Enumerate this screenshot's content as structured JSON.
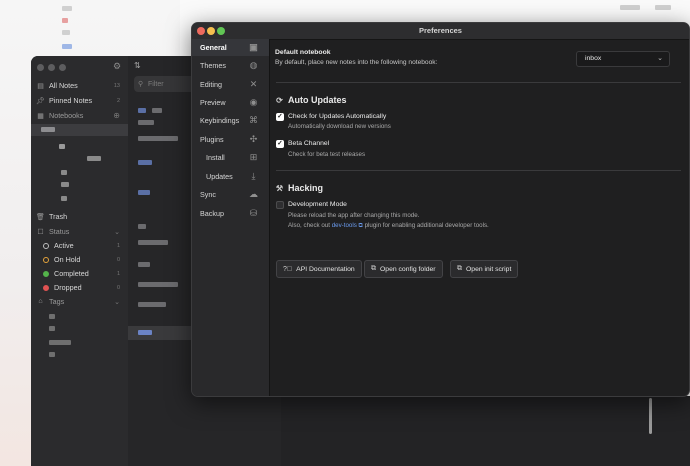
{
  "sidebar": {
    "all_notes": "All Notes",
    "all_notes_count": "13",
    "pinned_notes": "Pinned Notes",
    "pinned_count": "2",
    "notebooks": "Notebooks",
    "trash": "Trash",
    "status": "Status",
    "statuses": [
      {
        "label": "Active",
        "count": "1",
        "color": "#bdbdbd"
      },
      {
        "label": "On Hold",
        "count": "0",
        "color": "#e5a33b"
      },
      {
        "label": "Completed",
        "count": "1",
        "color": "#54b34b"
      },
      {
        "label": "Dropped",
        "count": "0",
        "color": "#e05252"
      }
    ],
    "tags": "Tags"
  },
  "list": {
    "filter_placeholder": "Filter"
  },
  "preferences": {
    "title": "Preferences",
    "nav": [
      {
        "label": "General",
        "icon": "general-icon"
      },
      {
        "label": "Themes",
        "icon": "palette-icon"
      },
      {
        "label": "Editing",
        "icon": "editing-icon"
      },
      {
        "label": "Preview",
        "icon": "eye-icon"
      },
      {
        "label": "Keybindings",
        "icon": "keyboard-icon"
      },
      {
        "label": "Plugins",
        "icon": "puzzle-icon"
      },
      {
        "label": "Install",
        "icon": "install-icon"
      },
      {
        "label": "Updates",
        "icon": "download-icon"
      },
      {
        "label": "Sync",
        "icon": "cloud-icon"
      },
      {
        "label": "Backup",
        "icon": "backup-icon"
      }
    ],
    "default_notebook": {
      "title": "Default notebook",
      "description": "By default, place new notes into the following notebook:",
      "value": "inbox"
    },
    "auto_updates": {
      "heading": "Auto Updates",
      "check_label": "Check for Updates Automatically",
      "check_desc": "Automatically download new versions",
      "beta_label": "Beta Channel",
      "beta_desc": "Check for beta test releases"
    },
    "hacking": {
      "heading": "Hacking",
      "dev_label": "Development Mode",
      "dev_desc": "Please reload the app after changing this mode.",
      "also_prefix": "Also, check out",
      "dev_tools_link": "dev-tools",
      "also_suffix": "plugin for enabling additional developer tools.",
      "buttons": [
        "API Documentation",
        "Open config folder",
        "Open init script"
      ]
    }
  }
}
